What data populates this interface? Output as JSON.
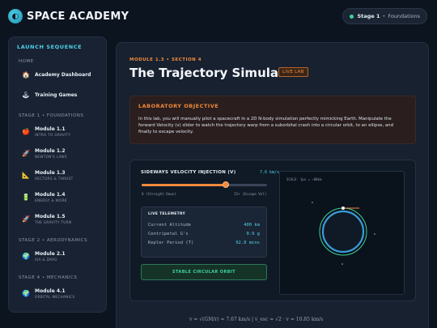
{
  "header": {
    "brand": "SPACE ACADEMY",
    "stage": "Stage 1",
    "separator": "•",
    "stage_name": "Foundations"
  },
  "sidebar": {
    "title": "LAUNCH SEQUENCE",
    "home_heading": "HOME",
    "home_items": [
      {
        "label": "Academy Dashboard",
        "icon": "house-icon"
      },
      {
        "label": "Training Games",
        "icon": "joystick-icon"
      }
    ],
    "stage1_heading": "STAGE 1 • FOUNDATIONS",
    "stage1_items": [
      {
        "label": "Module 1.1",
        "sub": "INTRO TO GRAVITY",
        "icon": "apple-icon"
      },
      {
        "label": "Module 1.2",
        "sub": "NEWTON'S LAWS",
        "icon": "rocket-icon"
      },
      {
        "label": "Module 1.3",
        "sub": "VECTORS & THRUST",
        "icon": "ruler-icon"
      },
      {
        "label": "Module 1.4",
        "sub": "ENERGY & WORK",
        "icon": "battery-icon"
      },
      {
        "label": "Module 1.5",
        "sub": "THE GRAVITY TURN",
        "icon": "rocket-icon"
      }
    ],
    "stage2_heading": "STAGE 2 • AERODYNAMICS",
    "stage2_items": [
      {
        "label": "Module 2.1",
        "sub": "ISA & DRAG",
        "icon": "globe-icon"
      }
    ],
    "stage4_heading": "STAGE 4 • MECHANICS",
    "stage4_items": [
      {
        "label": "Module 4.1",
        "sub": "ORBITAL MECHANICS",
        "icon": "globe-icon"
      }
    ]
  },
  "main": {
    "module_tag": "MODULE 1.3 • SECTION 4",
    "title": "The Trajectory Simulator",
    "badge": "LIVE LAB",
    "objective_title": "LABORATORY OBJECTIVE",
    "objective_text": "In this lab, you will manually pilot a spacecraft in a 2D N-body simulation perfectly mimicking Earth. Manipulate the forward Velocity (v) slider to watch the trajectory warp from a suborbital crash into a circular orbit, to an ellipse, and finally to escape velocity."
  },
  "simulator": {
    "velocity_label": "SIDEWAYS VELOCITY INJECTION (V)",
    "velocity_value": "7.6 km/s",
    "slider_fraction": 0.67,
    "slider_min_label": "0 (Straight Down)",
    "slider_max_label": "15+ (Escape Vel)",
    "telemetry_title": "LIVE TELEMETRY",
    "telemetry": [
      {
        "key": "Current Altitude",
        "value": "400 km"
      },
      {
        "key": "Centripetal G's",
        "value": "0.9 g"
      },
      {
        "key": "Kepler Period (T)",
        "value": "92.8 mins"
      }
    ],
    "orbit_status": "STABLE CIRCULAR ORBIT",
    "scale_label": "SCALE: 1px = ~80km"
  },
  "footer": {
    "formula": "v = √(GM/r) ≈ 7.67 km/s   |   v_esc = √2 · v ≈ 10.85 km/s"
  },
  "colors": {
    "accent_orange": "#f08a3c",
    "accent_cyan": "#4fd1e8",
    "accent_green": "#3fd49a"
  }
}
